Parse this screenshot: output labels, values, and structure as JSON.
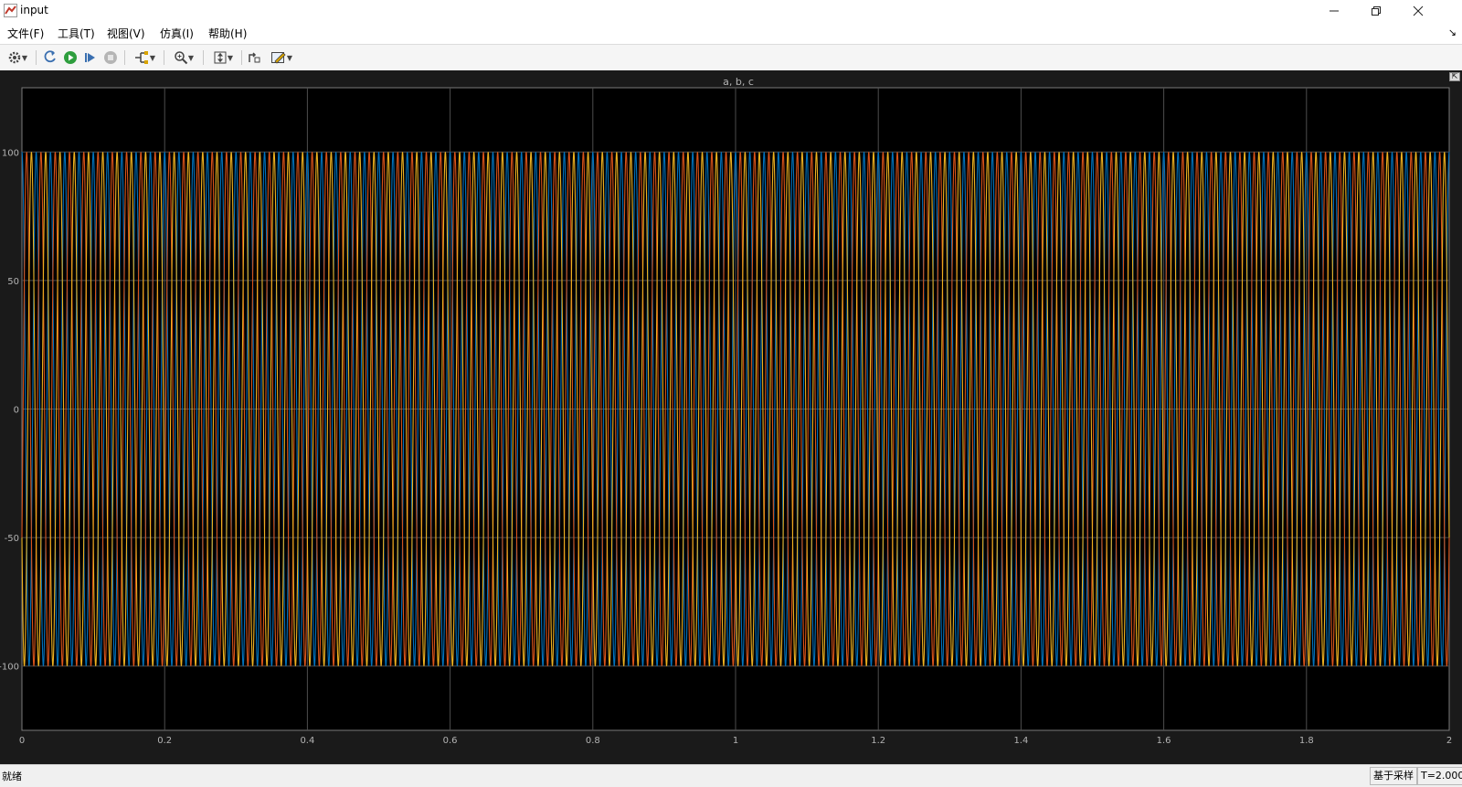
{
  "window": {
    "title": "input"
  },
  "menu": {
    "items": [
      {
        "label": "文件(F)"
      },
      {
        "label": "工具(T)"
      },
      {
        "label": "视图(V)"
      },
      {
        "label": "仿真(I)"
      },
      {
        "label": "帮助(H)"
      }
    ]
  },
  "toolbar": {
    "icons": [
      "settings-icon",
      "restore-icon",
      "run-icon",
      "step-forward-icon",
      "stop-icon",
      "signal-tools-icon",
      "zoom-icon",
      "autoscale-icon",
      "highlight-icon",
      "style-icon"
    ]
  },
  "status": {
    "left": "就绪",
    "sample_mode": "基于采样",
    "time": "T=2.000"
  },
  "colors": {
    "background": "#000000",
    "frame": "#1a1a1a",
    "grid": "#4d4d4d",
    "axis_text": "#b3b3b3",
    "series": [
      "#0072bd",
      "#d95319",
      "#edb120"
    ]
  },
  "chart_data": {
    "type": "line",
    "title": "a, b, c",
    "xlabel": "",
    "ylabel": "",
    "xlim": [
      0,
      2
    ],
    "ylim": [
      -125,
      125
    ],
    "xticks": [
      0,
      0.2,
      0.4,
      0.6,
      0.8,
      1,
      1.2,
      1.4,
      1.6,
      1.8,
      2
    ],
    "xtick_labels": [
      "0",
      "0.2",
      "0.4",
      "0.6",
      "0.8",
      "1",
      "1.2",
      "1.4",
      "1.6",
      "1.8",
      "2"
    ],
    "yticks": [
      100,
      50,
      0,
      -50,
      -100
    ],
    "ytick_labels": [
      "100",
      "50",
      "0",
      "-50",
      "-100"
    ],
    "grid": true,
    "series": [
      {
        "amplitude": 100,
        "frequency_hz": 50,
        "phase_deg": 90,
        "color": "#0072bd"
      },
      {
        "amplitude": 100,
        "frequency_hz": 50,
        "phase_deg": -30,
        "color": "#d95319"
      },
      {
        "amplitude": 100,
        "frequency_hz": 50,
        "phase_deg": 210,
        "color": "#edb120"
      }
    ]
  }
}
